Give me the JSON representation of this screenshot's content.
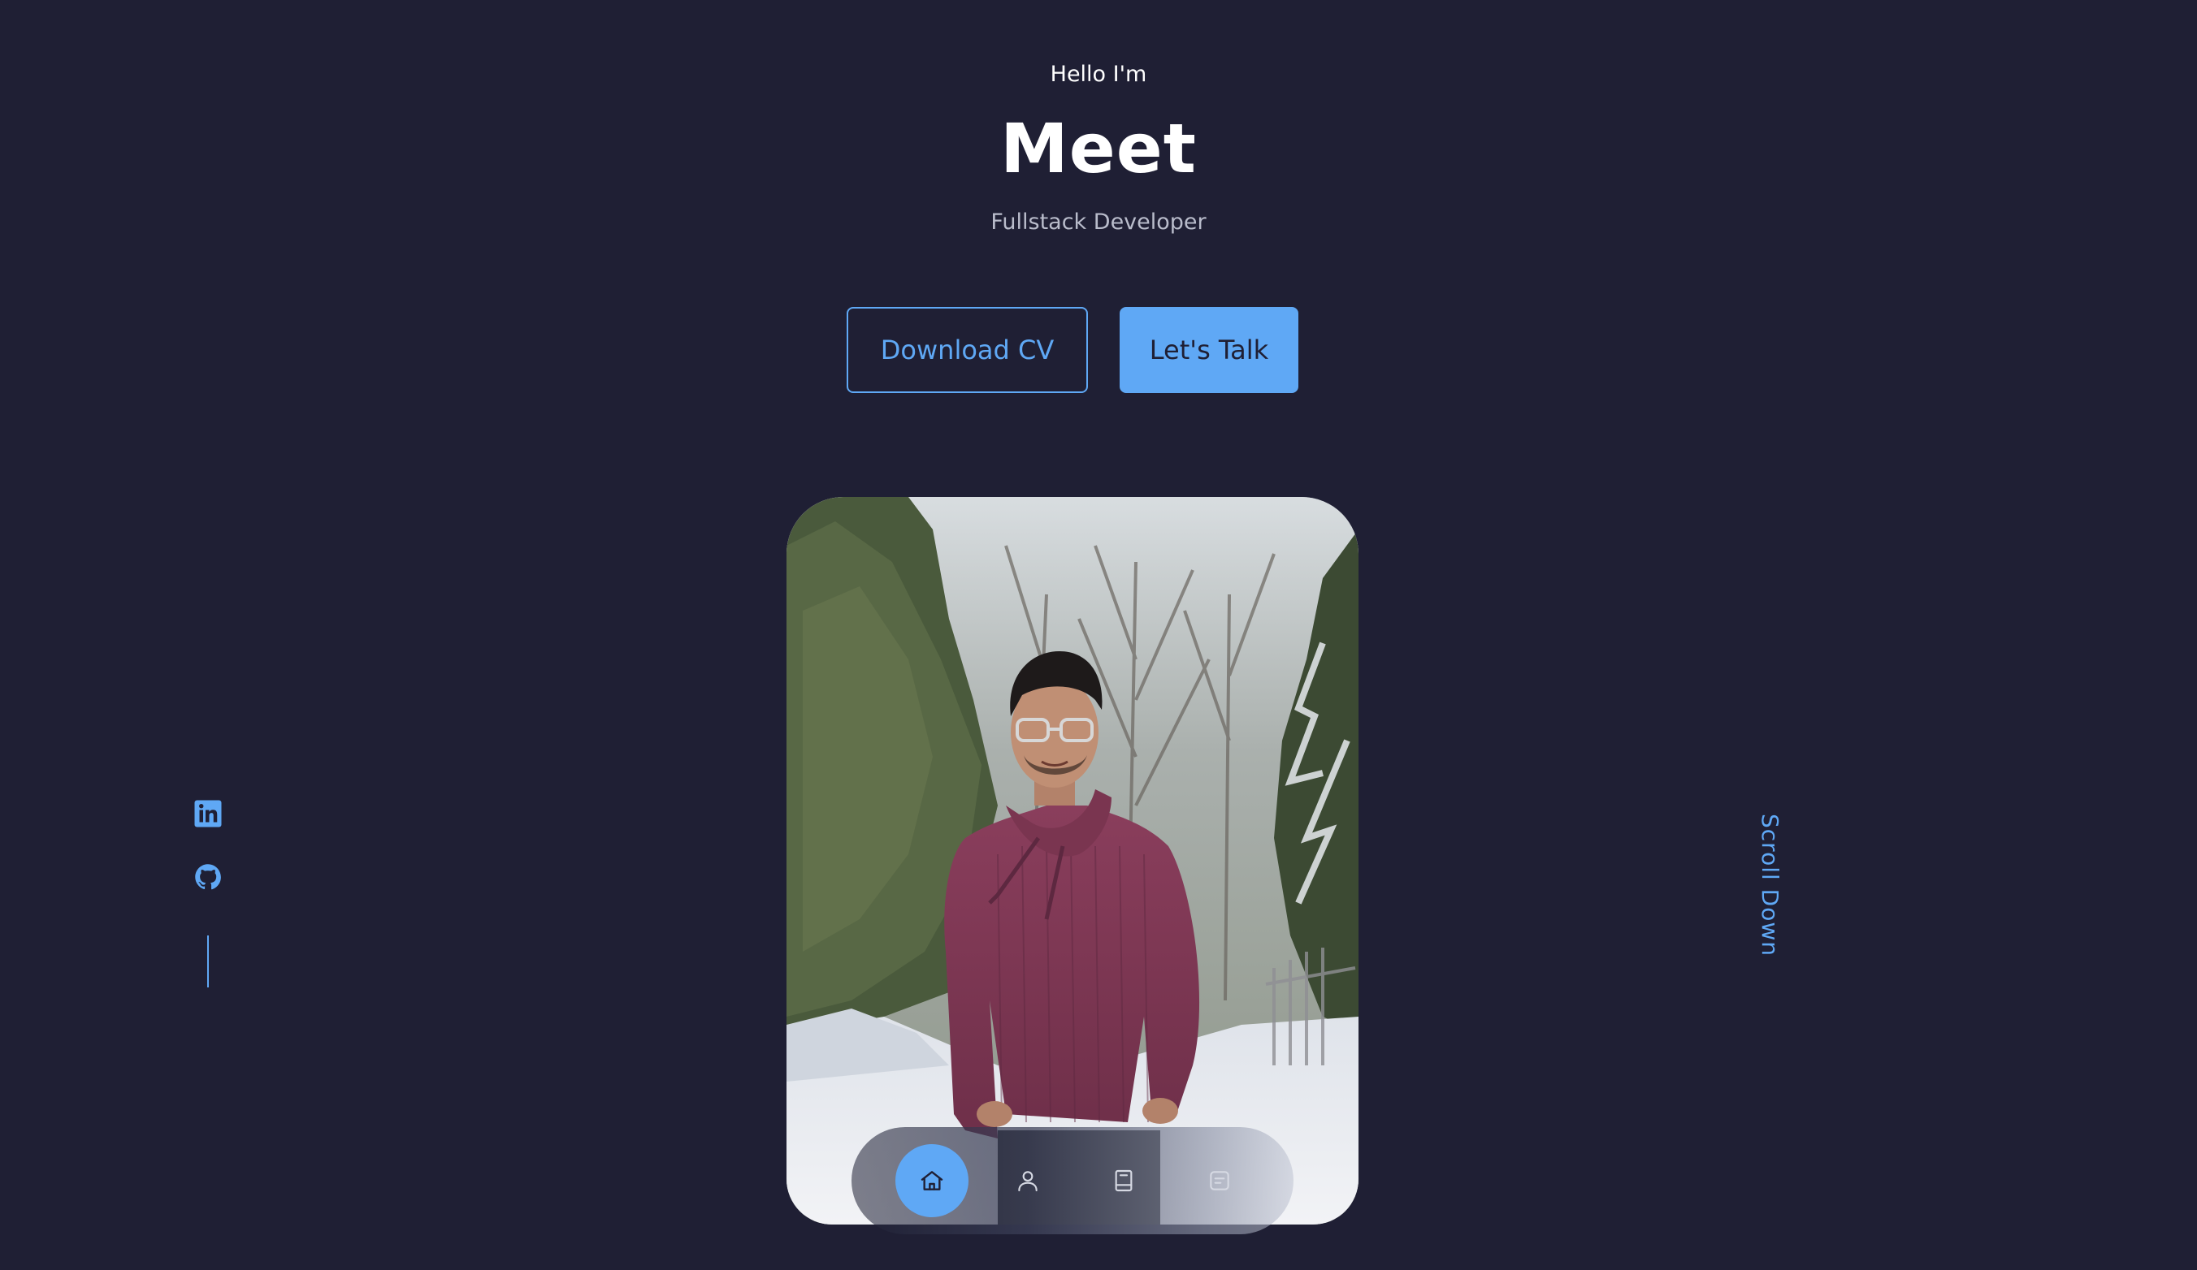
{
  "hero": {
    "greeting": "Hello I'm",
    "name": "Meet",
    "role": "Fullstack Developer"
  },
  "buttons": {
    "download_cv": "Download CV",
    "lets_talk": "Let's Talk"
  },
  "nav": {
    "items": [
      {
        "icon": "home-icon",
        "active": true
      },
      {
        "icon": "user-icon",
        "active": false
      },
      {
        "icon": "book-icon",
        "active": false
      },
      {
        "icon": "message-icon",
        "active": false
      }
    ]
  },
  "socials": [
    {
      "icon": "linkedin-icon"
    },
    {
      "icon": "github-icon"
    }
  ],
  "scroll": {
    "label": "Scroll Down"
  },
  "colors": {
    "background": "#1f1f34",
    "accent": "#5fa8f5",
    "text": "#ffffff",
    "muted": "#b9bccb"
  }
}
